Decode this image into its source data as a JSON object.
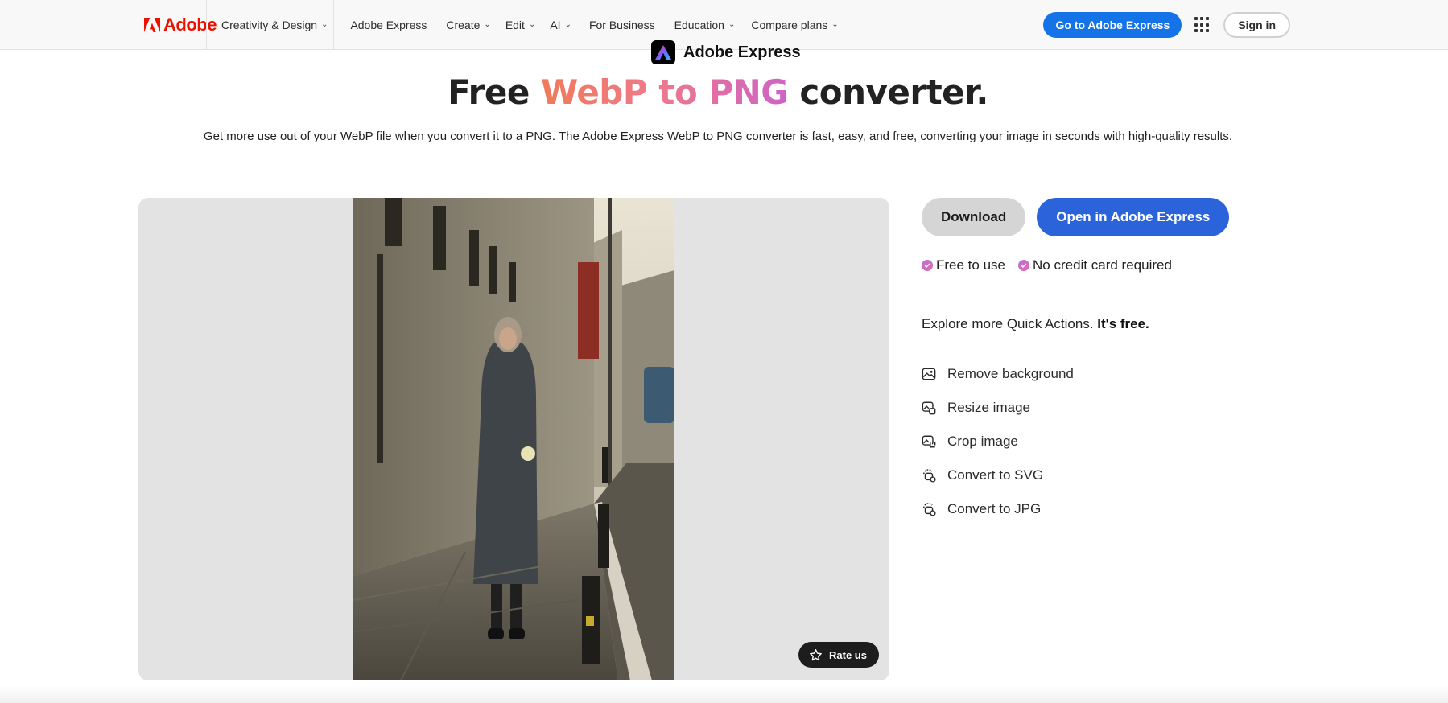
{
  "nav": {
    "logo_text": "Adobe",
    "items": [
      {
        "label": "Creativity & Design",
        "has_dropdown": true
      },
      {
        "label": "Adobe Express",
        "has_dropdown": false
      },
      {
        "label": "Create",
        "has_dropdown": true
      },
      {
        "label": "Edit",
        "has_dropdown": true
      },
      {
        "label": "AI",
        "has_dropdown": true
      },
      {
        "label": "For Business",
        "has_dropdown": false
      },
      {
        "label": "Education",
        "has_dropdown": true
      },
      {
        "label": "Compare plans",
        "has_dropdown": true
      }
    ],
    "cta_label": "Go to Adobe Express",
    "apps_icon": "apps-grid-icon",
    "signin_label": "Sign in"
  },
  "header": {
    "brand_name": "Adobe Express",
    "title_prefix": "Free ",
    "title_accent": "WebP to PNG",
    "title_suffix": " converter.",
    "description": "Get more use out of your WebP file when you convert it to a PNG. The Adobe Express WebP to PNG converter is fast, easy, and free, converting your image in seconds with high-quality results."
  },
  "preview": {
    "rate_label": "Rate us",
    "rate_icon": "star-outline-icon"
  },
  "actions": {
    "download_label": "Download",
    "open_label": "Open in Adobe Express"
  },
  "badges": [
    {
      "label": "Free to use",
      "icon": "check-circle-icon"
    },
    {
      "label": "No credit card required",
      "icon": "check-circle-icon"
    }
  ],
  "explore": {
    "text": "Explore more Quick Actions.",
    "bold": "It's free."
  },
  "quick_actions": [
    {
      "label": "Remove background",
      "icon": "remove-background-icon"
    },
    {
      "label": "Resize image",
      "icon": "resize-image-icon"
    },
    {
      "label": "Crop image",
      "icon": "crop-image-icon"
    },
    {
      "label": "Convert to SVG",
      "icon": "convert-icon"
    },
    {
      "label": "Convert to JPG",
      "icon": "convert-icon"
    }
  ],
  "colors": {
    "adobe_red": "#eb1000",
    "primary_blue": "#1473e6",
    "open_button_blue": "#2b63da",
    "accent_gradient_start": "#f07a58",
    "accent_gradient_end": "#cf62c7",
    "panel_gray": "#e3e3e3"
  }
}
